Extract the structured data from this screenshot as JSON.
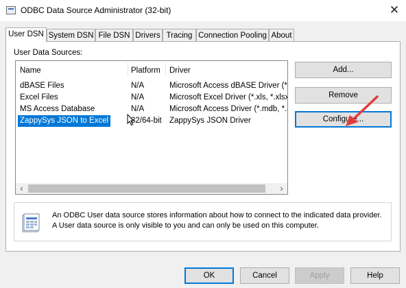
{
  "window": {
    "title": "ODBC Data Source Administrator (32-bit)",
    "close_glyph": "✕"
  },
  "tabs": [
    {
      "label": "User DSN",
      "active": true
    },
    {
      "label": "System DSN",
      "active": false
    },
    {
      "label": "File DSN",
      "active": false
    },
    {
      "label": "Drivers",
      "active": false
    },
    {
      "label": "Tracing",
      "active": false
    },
    {
      "label": "Connection Pooling",
      "active": false
    },
    {
      "label": "About",
      "active": false
    }
  ],
  "user_dsn": {
    "section_label": "User Data Sources:",
    "columns": {
      "name": "Name",
      "platform": "Platform",
      "driver": "Driver"
    },
    "rows": [
      {
        "name": "dBASE Files",
        "platform": "N/A",
        "driver": "Microsoft Access dBASE Driver (*.dbf",
        "selected": false
      },
      {
        "name": "Excel Files",
        "platform": "N/A",
        "driver": "Microsoft Excel Driver (*.xls, *.xlsx, *.",
        "selected": false
      },
      {
        "name": "MS Access Database",
        "platform": "N/A",
        "driver": "Microsoft Access Driver (*.mdb, *.ac",
        "selected": false
      },
      {
        "name": "ZappySys JSON to Excel",
        "platform": "32/64-bit",
        "driver": "ZappySys JSON Driver",
        "selected": true
      }
    ],
    "scroll_left": "‹",
    "scroll_right": "›",
    "buttons": {
      "add": "Add...",
      "remove": "Remove",
      "configure": "Configure..."
    },
    "info_text": "An ODBC User data source stores information about how to connect to the indicated data provider.   A User data source is only visible to you and can only be used on this computer."
  },
  "footer": {
    "ok": "OK",
    "cancel": "Cancel",
    "apply": "Apply",
    "help": "Help"
  },
  "colors": {
    "selection": "#0078d7",
    "annotation_arrow": "#e23b3b",
    "focus_border": "#0078d7"
  }
}
